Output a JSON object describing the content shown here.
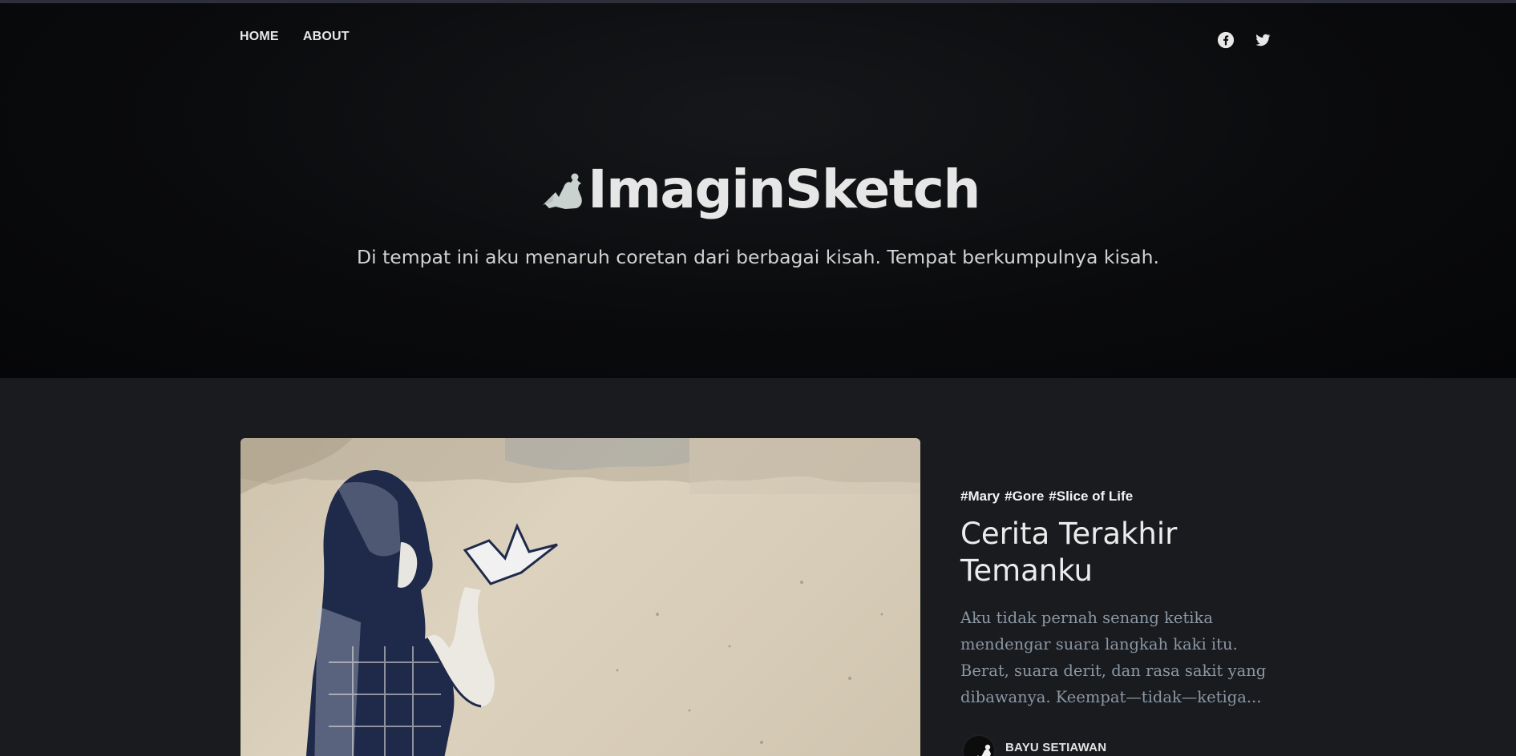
{
  "nav": {
    "items": [
      {
        "label": "HOME"
      },
      {
        "label": "ABOUT"
      }
    ]
  },
  "social": {
    "icons": [
      "facebook-icon",
      "twitter-icon"
    ]
  },
  "hero": {
    "logo_text": "ImaginSketch",
    "tagline": "Di tempat ini aku menaruh coretan dari berbagai kisah. Tempat berkumpulnya kisah."
  },
  "featured_post": {
    "tags": [
      "#Mary",
      "#Gore",
      "#Slice of Life"
    ],
    "title": "Cerita Terakhir Temanku",
    "excerpt": "Aku tidak pernah senang ketika mendengar suara langkah kaki itu. Berat, suara derit, dan rasa sakit yang dibawanya. Keempat—tidak—ketiga...",
    "author": "BAYU SETIAWAN"
  },
  "colors": {
    "page_bg": "#191b1f",
    "hero_bg": "#0a0b0d",
    "excerpt": "#8b97a3"
  }
}
